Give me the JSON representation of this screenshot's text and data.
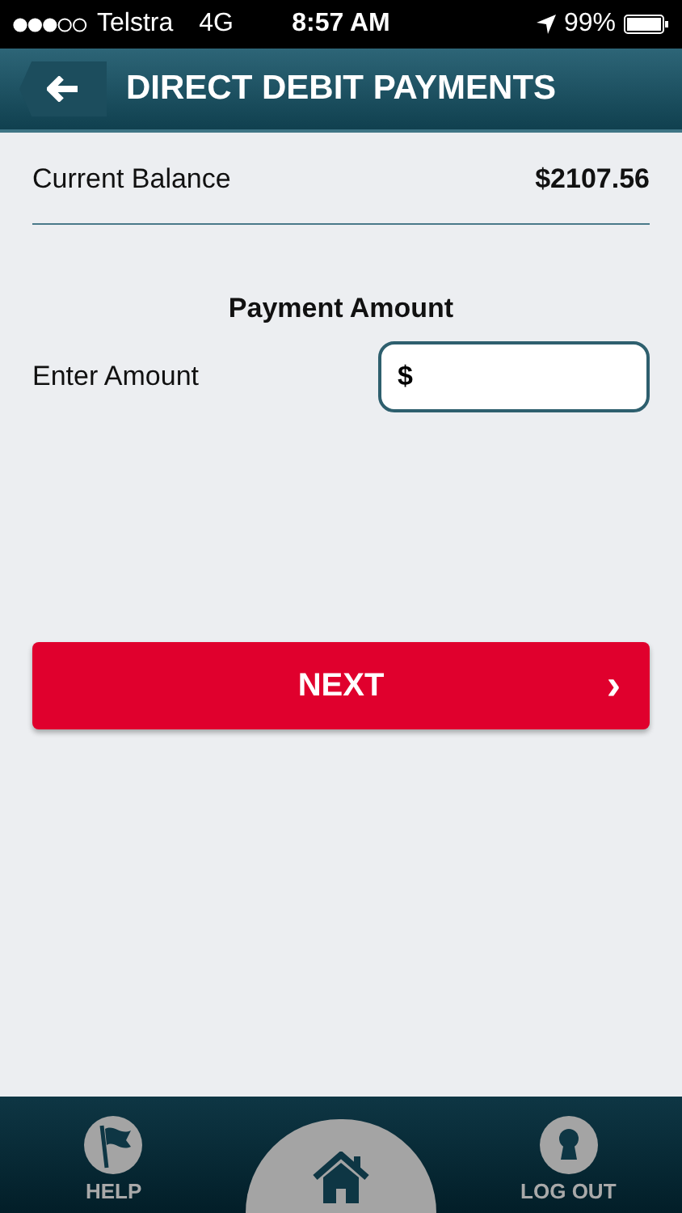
{
  "status_bar": {
    "carrier": "Telstra",
    "network": "4G",
    "time": "8:57 AM",
    "battery": "99%"
  },
  "header": {
    "title": "DIRECT DEBIT PAYMENTS"
  },
  "balance": {
    "label": "Current Balance",
    "value": "$2107.56"
  },
  "payment": {
    "heading": "Payment Amount",
    "label": "Enter Amount",
    "prefix": "$"
  },
  "next_button": {
    "label": "NEXT",
    "arrow": "›"
  },
  "tab_bar": [
    {
      "kind": "help",
      "label": "HELP"
    },
    {
      "kind": "home"
    },
    {
      "kind": "logout",
      "label": "LOG OUT"
    }
  ]
}
